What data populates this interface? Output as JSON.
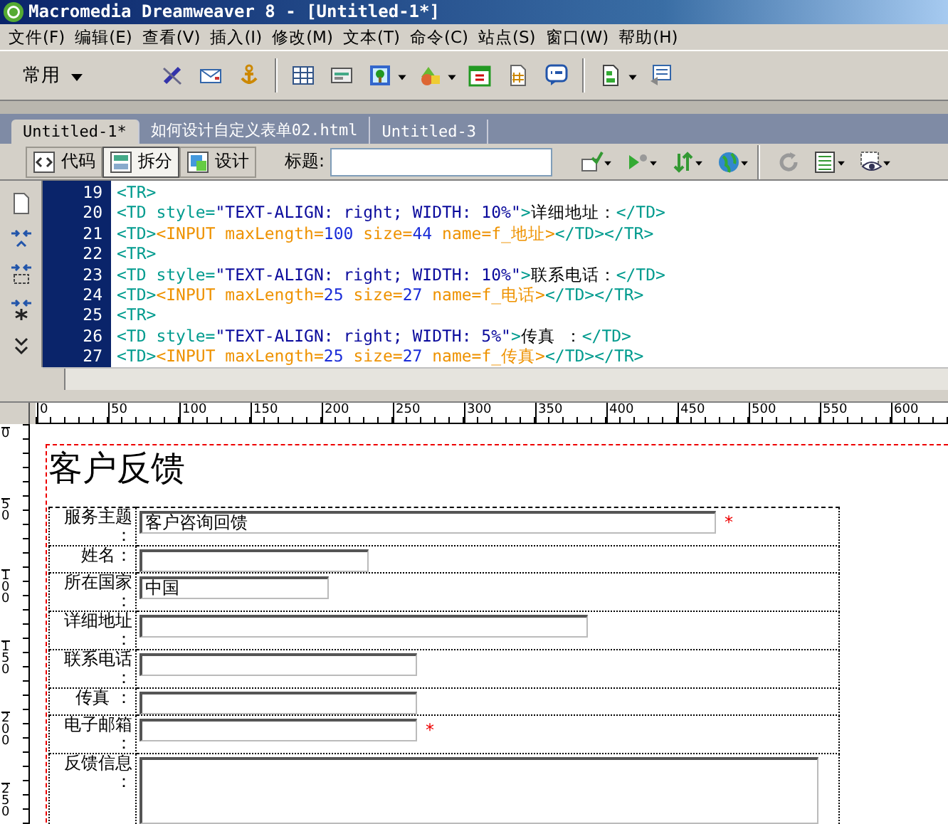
{
  "window": {
    "title": "Macromedia Dreamweaver 8 - [Untitled-1*]"
  },
  "menu": [
    "文件(F)",
    "编辑(E)",
    "查看(V)",
    "插入(I)",
    "修改(M)",
    "文本(T)",
    "命令(C)",
    "站点(S)",
    "窗口(W)",
    "帮助(H)"
  ],
  "insert_bar": {
    "category": "常用"
  },
  "document_tabs": [
    {
      "label": "Untitled-1*",
      "selected": true
    },
    {
      "label": "如何设计自定义表单02.html",
      "selected": false
    },
    {
      "label": "Untitled-3",
      "selected": false
    }
  ],
  "view_buttons": [
    {
      "label": "代码",
      "selected": false
    },
    {
      "label": "拆分",
      "selected": true
    },
    {
      "label": "设计",
      "selected": false
    }
  ],
  "title_field": {
    "label": "标题:"
  },
  "code_lines": [
    {
      "number": "19",
      "segments": [
        {
          "kind": "tag",
          "text": "<TR>"
        }
      ]
    },
    {
      "number": "20",
      "segments": [
        {
          "kind": "tag",
          "text": "<TD style="
        },
        {
          "kind": "value",
          "text": "\"TEXT-ALIGN: right; WIDTH: 10%\""
        },
        {
          "kind": "tag",
          "text": ">"
        },
        {
          "kind": "text",
          "text": "详细地址："
        },
        {
          "kind": "tag",
          "text": "</TD>"
        }
      ]
    },
    {
      "number": "21",
      "segments": [
        {
          "kind": "tag",
          "text": "<TD>"
        },
        {
          "kind": "input",
          "text": "<INPUT maxLength="
        },
        {
          "kind": "number",
          "text": "100"
        },
        {
          "kind": "input",
          "text": " size="
        },
        {
          "kind": "number",
          "text": "44"
        },
        {
          "kind": "input",
          "text": " name=f_地址>"
        },
        {
          "kind": "tag",
          "text": "</TD></TR>"
        }
      ]
    },
    {
      "number": "22",
      "segments": [
        {
          "kind": "tag",
          "text": "<TR>"
        }
      ]
    },
    {
      "number": "23",
      "segments": [
        {
          "kind": "tag",
          "text": "<TD style="
        },
        {
          "kind": "value",
          "text": "\"TEXT-ALIGN: right; WIDTH: 10%\""
        },
        {
          "kind": "tag",
          "text": ">"
        },
        {
          "kind": "text",
          "text": "联系电话："
        },
        {
          "kind": "tag",
          "text": "</TD>"
        }
      ]
    },
    {
      "number": "24",
      "segments": [
        {
          "kind": "tag",
          "text": "<TD>"
        },
        {
          "kind": "input",
          "text": "<INPUT maxLength="
        },
        {
          "kind": "number",
          "text": "25"
        },
        {
          "kind": "input",
          "text": " size="
        },
        {
          "kind": "number",
          "text": "27"
        },
        {
          "kind": "input",
          "text": " name=f_电话>"
        },
        {
          "kind": "tag",
          "text": "</TD></TR>"
        }
      ]
    },
    {
      "number": "25",
      "segments": [
        {
          "kind": "tag",
          "text": "<TR>"
        }
      ]
    },
    {
      "number": "26",
      "segments": [
        {
          "kind": "tag",
          "text": "<TD style="
        },
        {
          "kind": "value",
          "text": "\"TEXT-ALIGN: right; WIDTH: 5%\""
        },
        {
          "kind": "tag",
          "text": ">"
        },
        {
          "kind": "text",
          "text": "传真 ："
        },
        {
          "kind": "tag",
          "text": "</TD>"
        }
      ]
    },
    {
      "number": "27",
      "segments": [
        {
          "kind": "tag",
          "text": "<TD>"
        },
        {
          "kind": "input",
          "text": "<INPUT maxLength="
        },
        {
          "kind": "number",
          "text": "25"
        },
        {
          "kind": "input",
          "text": " size="
        },
        {
          "kind": "number",
          "text": "27"
        },
        {
          "kind": "input",
          "text": " name=f_传真>"
        },
        {
          "kind": "tag",
          "text": "</TD></TR>"
        }
      ]
    }
  ],
  "ruler": {
    "horizontal": [
      "0",
      "50",
      "100",
      "150",
      "200",
      "250",
      "300",
      "350",
      "400",
      "450",
      "500",
      "550",
      "600"
    ],
    "vertical": [
      "0",
      "50",
      "100",
      "150",
      "200",
      "250"
    ]
  },
  "page": {
    "heading": "客户反馈",
    "rows": [
      {
        "label": "服务主题：",
        "kind": "text",
        "value": "客户咨询回馈",
        "note": "*"
      },
      {
        "label": "姓名：",
        "kind": "text"
      },
      {
        "label": "所在国家：",
        "kind": "text",
        "value": "中国"
      },
      {
        "label": "详细地址：",
        "kind": "text"
      },
      {
        "label": "联系电话：",
        "kind": "text"
      },
      {
        "label": "传真 ：",
        "kind": "text"
      },
      {
        "label": "电子邮箱：",
        "kind": "text",
        "note": "*"
      },
      {
        "label": "反馈信息：",
        "kind": "textarea"
      }
    ]
  }
}
